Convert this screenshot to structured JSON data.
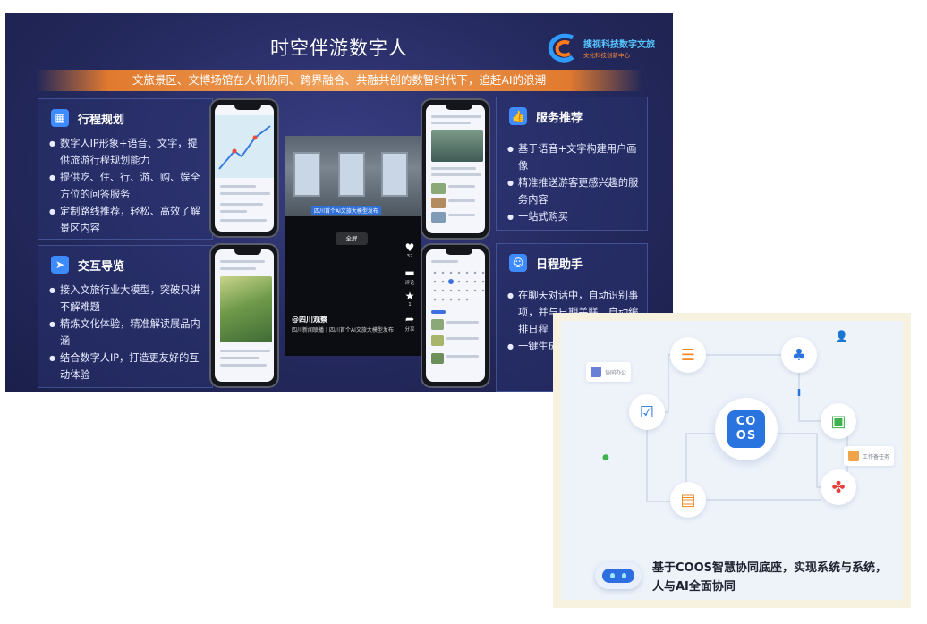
{
  "slide": {
    "title": "时空伴游数字人",
    "logo": {
      "line1": "搜视科技",
      "line2": "文化科技"
    },
    "banner": "文旅景区、文博场馆在人机协同、跨界融合、共融共创的数智时代下，追赶AI的浪潮",
    "panels": {
      "itinerary": {
        "title": "行程规划",
        "icon": "calendar-icon",
        "bullets": [
          "数字人IP形象+语音、文字，提供旅游行程规划能力",
          "提供吃、住、行、游、购、娱全方位的问答服务",
          "定制路线推荐，轻松、高效了解景区内容"
        ]
      },
      "service": {
        "title": "服务推荐",
        "icon": "thumbs-up-icon",
        "bullets": [
          "基于语音+文字构建用户画像",
          "精准推送游客更感兴趣的服务内容",
          "一站式购买"
        ]
      },
      "guide": {
        "title": "交互导览",
        "icon": "navigation-arrow-icon",
        "bullets": [
          "接入文旅行业大模型，突破只讲不解难题",
          "精炼文化体验，精准解读展品内涵",
          "结合数字人IP，打造更友好的互动体验"
        ]
      },
      "schedule": {
        "title": "日程助手",
        "icon": "robot-icon",
        "bullets": [
          "在聊天对话中，自动识别事项，并与日期关联，自动编排日程",
          "一键生成日程，进行提醒"
        ]
      }
    },
    "video": {
      "caption": "四川首个AI文旅大模型发布",
      "full_button": "全屏",
      "username": "@四川观察",
      "description": "四川新闻联播丨四川首个AI文旅大模型发布",
      "side": [
        {
          "icon": "heart-icon",
          "label": "32"
        },
        {
          "icon": "comment-icon",
          "label": "评论"
        },
        {
          "icon": "star-icon",
          "label": "1"
        },
        {
          "icon": "share-icon",
          "label": "分享"
        }
      ]
    }
  },
  "coos": {
    "logo_text": [
      "CO",
      "OS"
    ],
    "tags": {
      "collab_office": "协同办公",
      "work_task": "工作备任务"
    },
    "footer_line1": "基于COOS智慧协同底座，实现系统与系统，",
    "footer_line2": "人与AI全面协同",
    "colors": {
      "accent": "#2a74e0",
      "orange": "#f08a2b",
      "green": "#3fb24f",
      "red": "#e8413b"
    }
  }
}
